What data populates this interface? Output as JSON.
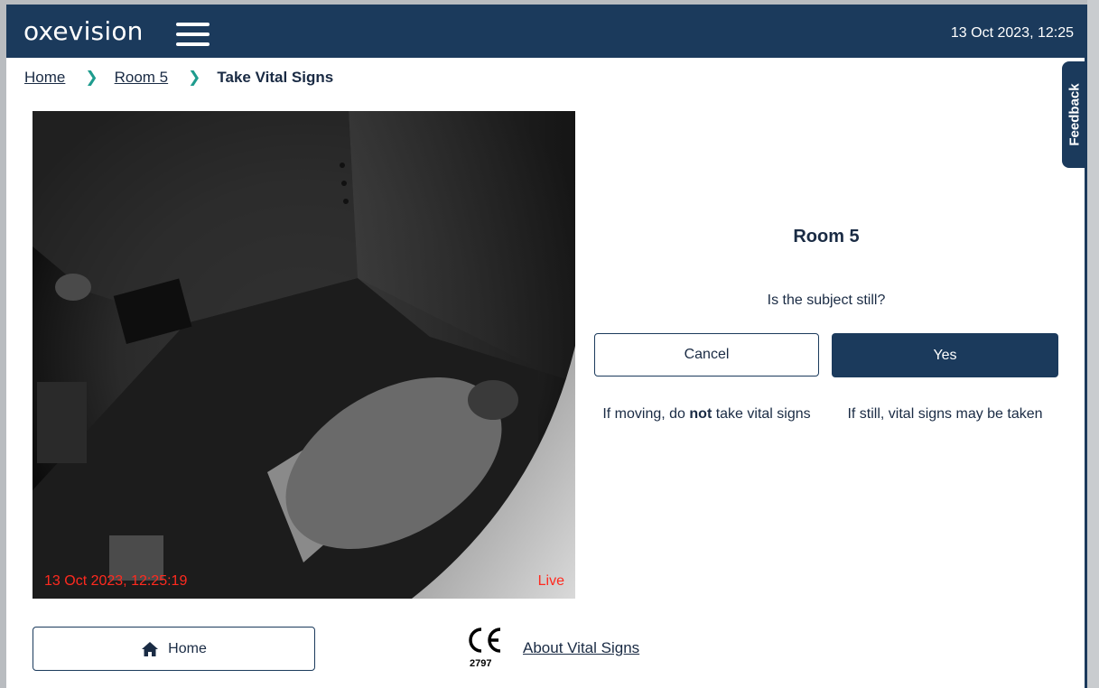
{
  "header": {
    "logo": "oxevision",
    "datetime": "13 Oct 2023, 12:25"
  },
  "breadcrumb": [
    {
      "label": "Home"
    },
    {
      "label": "Room 5"
    },
    {
      "label": "Take Vital Signs"
    }
  ],
  "feedback_label": "Feedback",
  "camera": {
    "timestamp": "13 Oct 2023, 12:25:19",
    "status": "Live"
  },
  "panel": {
    "room_title": "Room 5",
    "question": "Is the subject still?",
    "cancel_label": "Cancel",
    "yes_label": "Yes",
    "hint_moving_prefix": "If moving, do ",
    "hint_moving_emphasis": "not",
    "hint_moving_suffix": " take vital signs",
    "hint_still": "If still, vital signs may be taken"
  },
  "footer": {
    "home_label": "Home",
    "ce_number": "2797",
    "about_link": "About Vital Signs"
  },
  "colors": {
    "brand_navy": "#1b3a5c",
    "breadcrumb_chevron": "#1e9c8e",
    "camera_overlay_text": "#ff2a1f"
  }
}
